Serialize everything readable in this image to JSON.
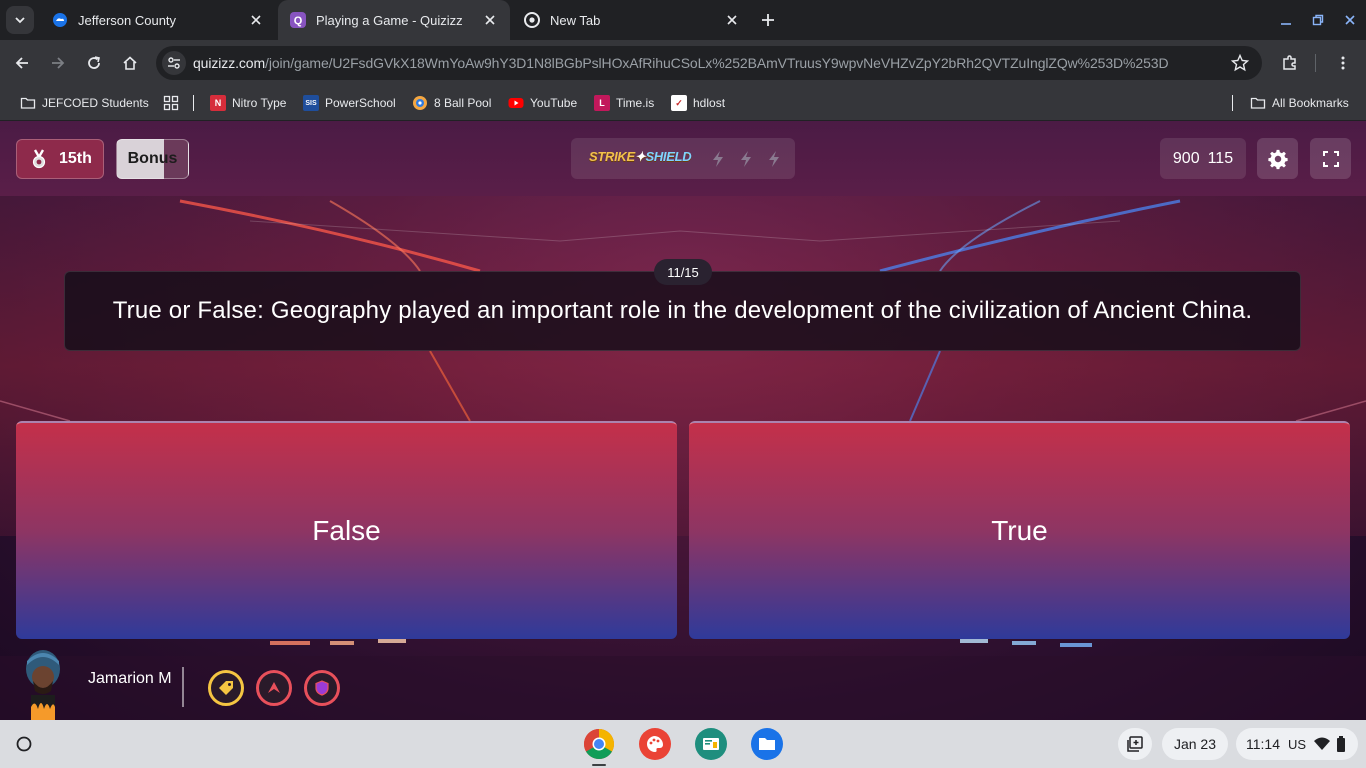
{
  "browser": {
    "tabs": [
      {
        "title": "Jefferson County",
        "active": false
      },
      {
        "title": "Playing a Game - Quizizz",
        "active": true
      },
      {
        "title": "New Tab",
        "active": false
      }
    ],
    "url_host": "quizizz.com",
    "url_path": "/join/game/U2FsdGVkX18WmYoAw9hY3D1N8lBGbPslHOxAfRihuCSoLx%252BAmVTruusY9wpvNeVHZvZpY2bRh2QVTZuInglZQw%253D%253D",
    "bookmarks": [
      "JEFCOED Students",
      "Nitro Type",
      "PowerSchool",
      "8 Ball Pool",
      "YouTube",
      "Time.is",
      "hdlost"
    ],
    "all_bookmarks": "All Bookmarks"
  },
  "game": {
    "rank": "15th",
    "bonus_label": "Bonus",
    "bonus_progress": 0.66,
    "mode_logo_a": "STRIKE",
    "mode_logo_b": "SHIELD",
    "score": "900",
    "streak": "115",
    "question_counter": "11/15",
    "question": "True or False: Geography played an important role in the development of the civilization of Ancient China.",
    "answers": [
      "False",
      "True"
    ],
    "player_name": "Jamarion M",
    "powerups": [
      "power-up-yellow",
      "power-up-red-arrow",
      "power-up-red-shield"
    ],
    "colors": {
      "answer_top": "#c4304a",
      "answer_bottom": "#2f3a9a",
      "rank_bg": "#8e2a4b"
    }
  },
  "shelf": {
    "date": "Jan 23",
    "time": "11:14",
    "locale": "US",
    "apps": [
      "chrome",
      "canvas",
      "classroom",
      "files"
    ]
  }
}
